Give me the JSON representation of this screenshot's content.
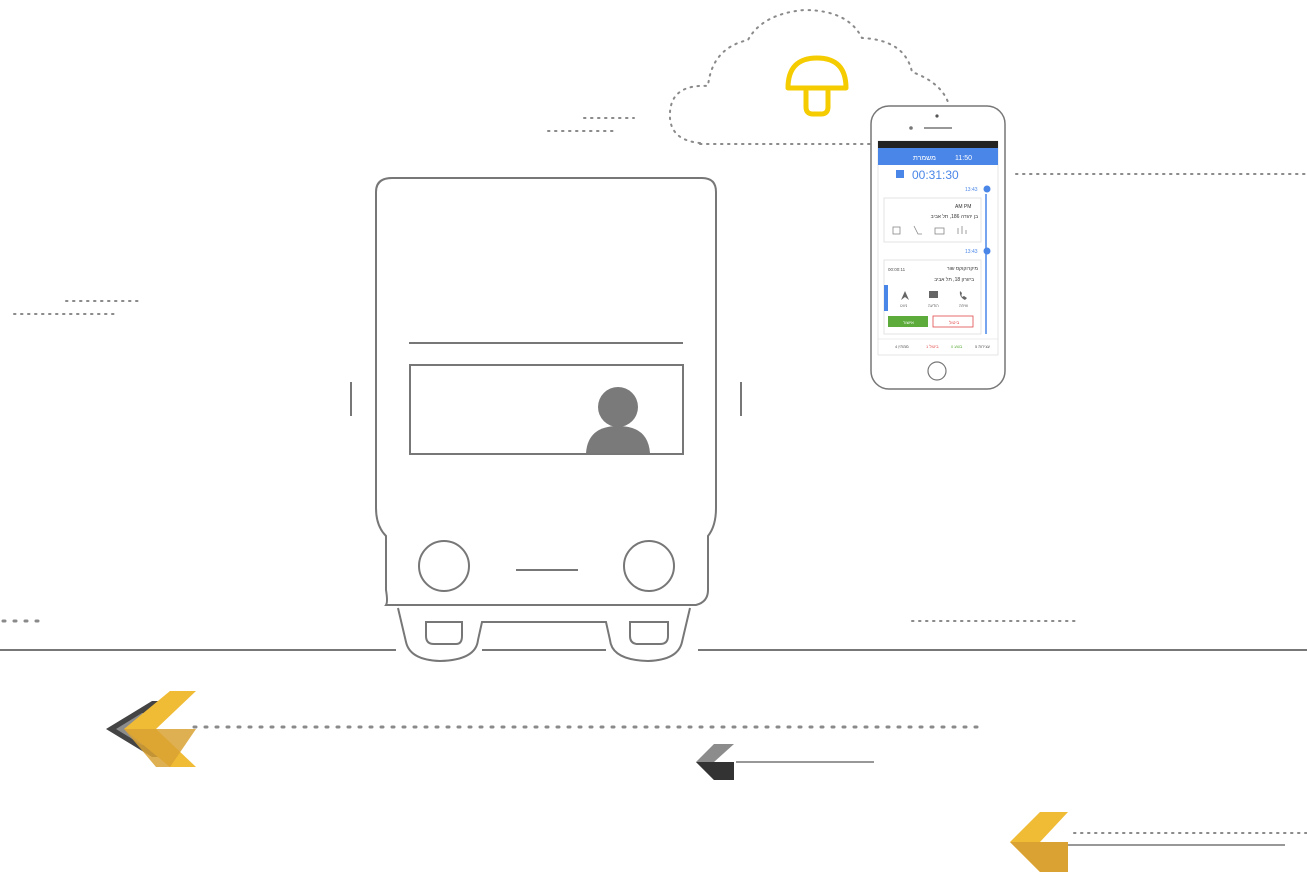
{
  "colors": {
    "line": "#777777",
    "dots": "#8a8a8a",
    "accent_yellow": "#f5cc00",
    "arrow_yellow": "#f0bb35",
    "arrow_yellow_dark": "#d9a233",
    "arrow_grey": "#8c8c8c",
    "arrow_grey_dark": "#444444",
    "app_blue": "#4a86e8",
    "app_green": "#5cab3b",
    "app_red": "#e24848"
  },
  "icons": [
    "cloud-icon",
    "mushroom-icon",
    "bus-icon",
    "driver-icon",
    "arrow-icon"
  ],
  "phone": {
    "status_time": "11:50",
    "header_title": "משמרת",
    "timer": "00:31:30",
    "stops": [
      {
        "time": "13:43",
        "name": "AM PM",
        "address": "בן יהודה 186, תל אביב"
      },
      {
        "time": "13:43",
        "name": "מיקרוקוקס שור",
        "eta": "00:00:11",
        "address": "ביזורון 18, תל אביב",
        "actions": [
          "ניווט",
          "הודעה",
          "שיחה"
        ],
        "confirm_label": "אישור",
        "cancel_label": "ביטול"
      }
    ],
    "footer": [
      "עצירות 5",
      "בוצע 0",
      "ביטול 1",
      "ממתין 4"
    ]
  }
}
